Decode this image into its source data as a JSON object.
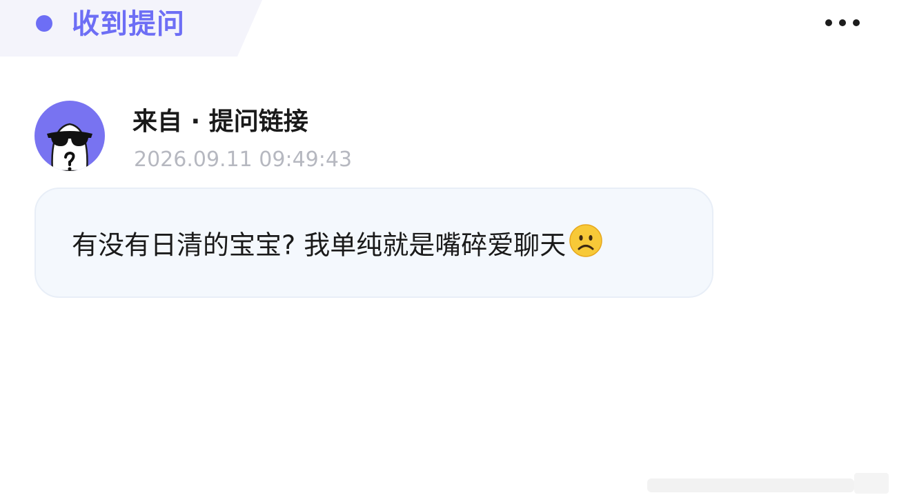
{
  "header": {
    "title": "收到提问",
    "accent_color": "#6d6ef5",
    "more_icon": "more-horizontal-icon"
  },
  "sender": {
    "avatar_icon": "anonymous-sunglasses-avatar",
    "avatar_color": "#7873f1",
    "source_label": "来自 · 提问链接",
    "timestamp": "2026.09.11 09:49:43"
  },
  "question": {
    "text": "有没有日清的宝宝? 我单纯就是嘴碎爱聊天",
    "emoji": "frowning-face-emoji"
  }
}
